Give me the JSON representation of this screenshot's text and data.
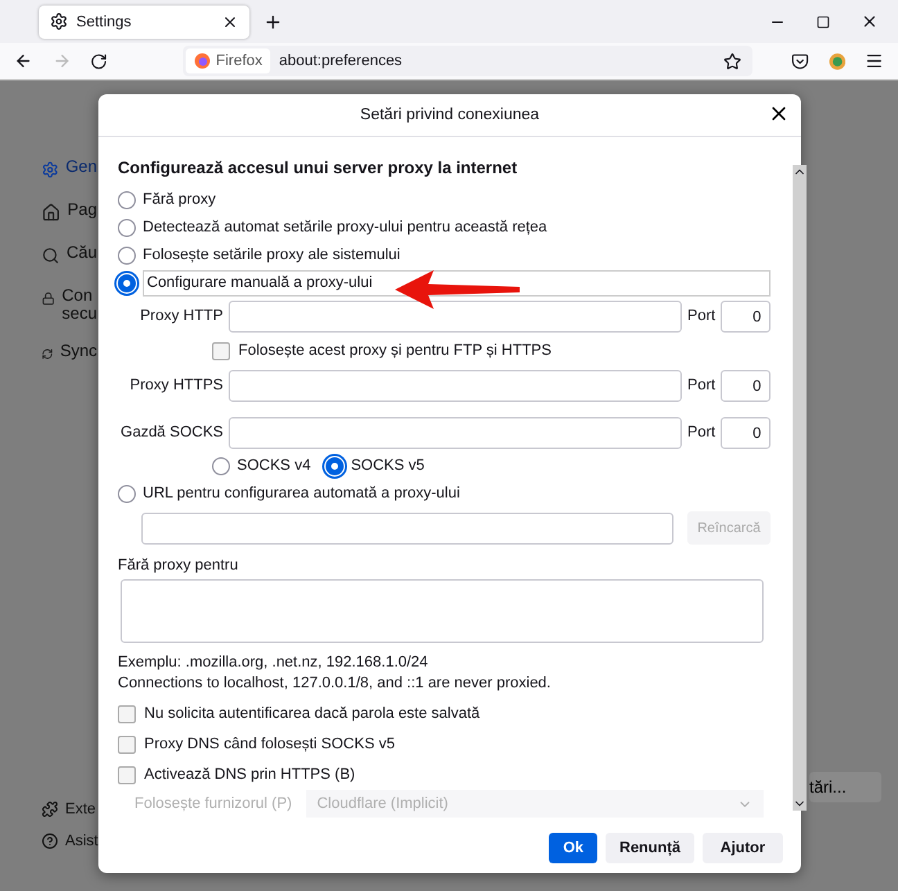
{
  "browser": {
    "tab": {
      "title": "Settings"
    },
    "identity": "Firefox",
    "url": "about:preferences"
  },
  "background": {
    "sidebar": [
      {
        "label": "Gen",
        "selected": true
      },
      {
        "label": "Pag",
        "selected": false
      },
      {
        "label": "Cău",
        "selected": false
      },
      {
        "label": "Con\nsecu",
        "selected": false
      },
      {
        "label": "Sync",
        "selected": false
      }
    ],
    "bottom_links": [
      "Exte",
      "Asist"
    ],
    "button": "tări..."
  },
  "dialog": {
    "title": "Setări privind conexiunea",
    "heading": "Configurează accesul unui server proxy la internet",
    "modes": [
      {
        "label": "Fără proxy",
        "selected": false
      },
      {
        "label": "Detectează automat setările proxy-ului pentru această rețea",
        "selected": false
      },
      {
        "label": "Folosește setările proxy ale sistemului",
        "selected": false
      },
      {
        "label": "Configurare manuală a proxy-ului",
        "selected": true
      }
    ],
    "http": {
      "label": "Proxy HTTP",
      "port_label": "Port",
      "port": "0"
    },
    "share": {
      "label": "Folosește acest proxy și pentru FTP și HTTPS",
      "checked": false
    },
    "https": {
      "label": "Proxy HTTPS",
      "port_label": "Port",
      "port": "0"
    },
    "socks": {
      "label": "Gazdă SOCKS",
      "port_label": "Port",
      "port": "0"
    },
    "socks_versions": [
      {
        "label": "SOCKS v4",
        "selected": false
      },
      {
        "label": "SOCKS v5",
        "selected": true
      }
    ],
    "auto_url": {
      "label": "URL pentru configurarea automată a proxy-ului",
      "selected": false,
      "reload": "Reîncarcă"
    },
    "no_proxy_label": "Fără proxy pentru",
    "example": "Exemplu: .mozilla.org, .net.nz, 192.168.1.0/24",
    "note": "Connections to localhost, 127.0.0.1/8, and ::1 are never proxied.",
    "options": [
      {
        "label": "Nu solicita autentificarea dacă parola este salvată",
        "checked": false
      },
      {
        "label": "Proxy DNS când folosești SOCKS v5",
        "checked": false
      },
      {
        "label": "Activează DNS prin HTTPS (B)",
        "checked": false
      }
    ],
    "provider": {
      "label": "Folosește furnizorul (P)",
      "value": "Cloudflare (Implicit)"
    },
    "buttons": [
      {
        "label": "Ok",
        "kind": "primary"
      },
      {
        "label": "Renunță",
        "kind": "default"
      },
      {
        "label": "Ajutor",
        "kind": "default"
      }
    ]
  }
}
